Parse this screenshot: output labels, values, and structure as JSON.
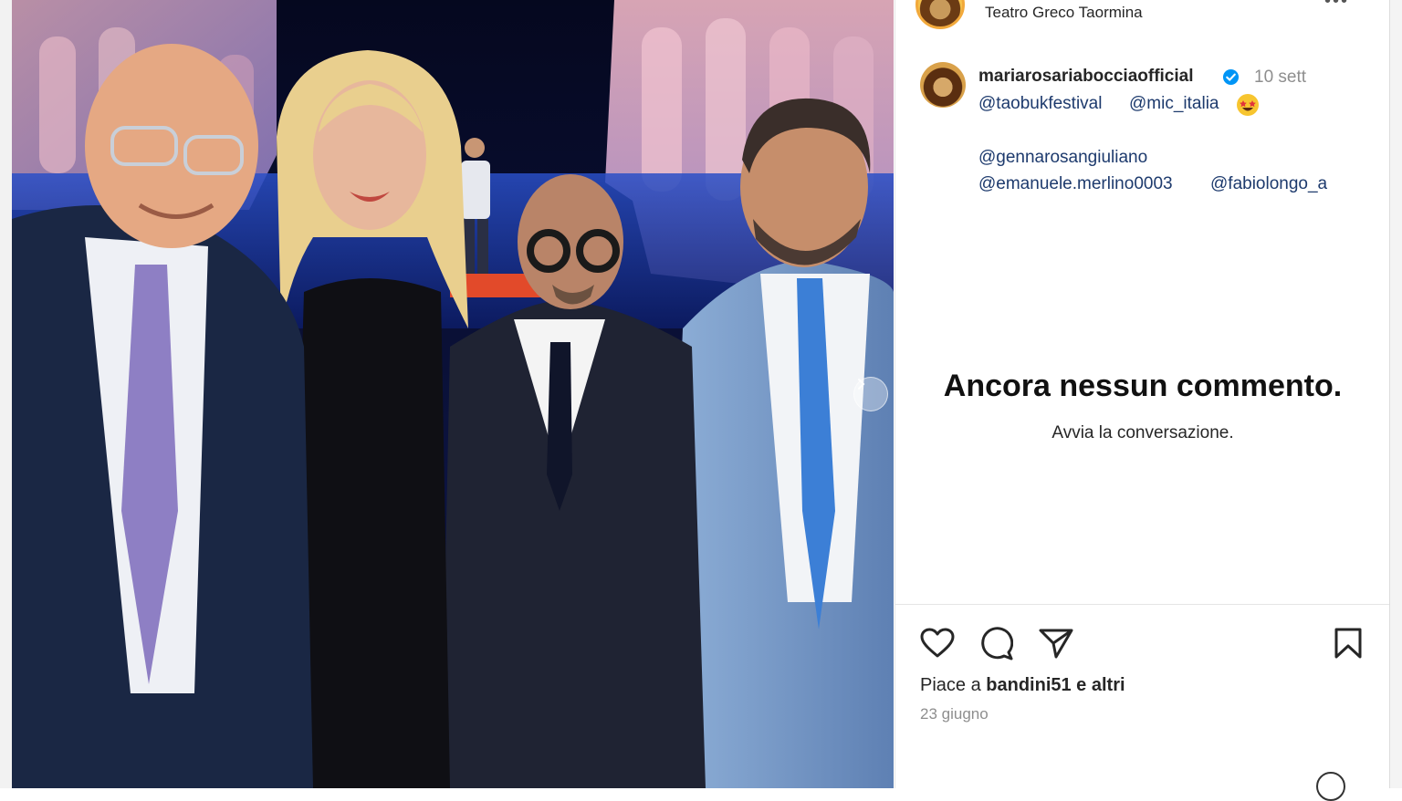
{
  "post": {
    "location": "Teatro Greco Taormina",
    "username": "mariarosariaboccia official",
    "username_display": "mariarosariabocciaofficial",
    "time_ago": "10 sett",
    "caption_mentions_line1": [
      "@taobukfestival",
      "@mic_italia"
    ],
    "caption_mentions_line2": [
      "@gennarosangiuliano"
    ],
    "caption_mentions_line3": [
      "@emanuele.merlino0003",
      "@fabiolongo_a"
    ],
    "emoji": "star-struck-emoji"
  },
  "comments": {
    "empty_title": "Ancora nessun commento.",
    "empty_subtitle": "Avvia la conversazione."
  },
  "actions": {
    "likes_prefix": "Piace a ",
    "likes_user": "bandini51",
    "likes_suffix": " e altri",
    "date": "23 giugno"
  },
  "icons": [
    "heart-icon",
    "comment-icon",
    "share-icon",
    "bookmark-icon",
    "chevron-right-icon",
    "verified-icon",
    "more-icon",
    "emoji-icon"
  ],
  "colors": {
    "verified": "#0095f6",
    "mention": "#1d3a6d",
    "muted": "#8e8e8e"
  }
}
